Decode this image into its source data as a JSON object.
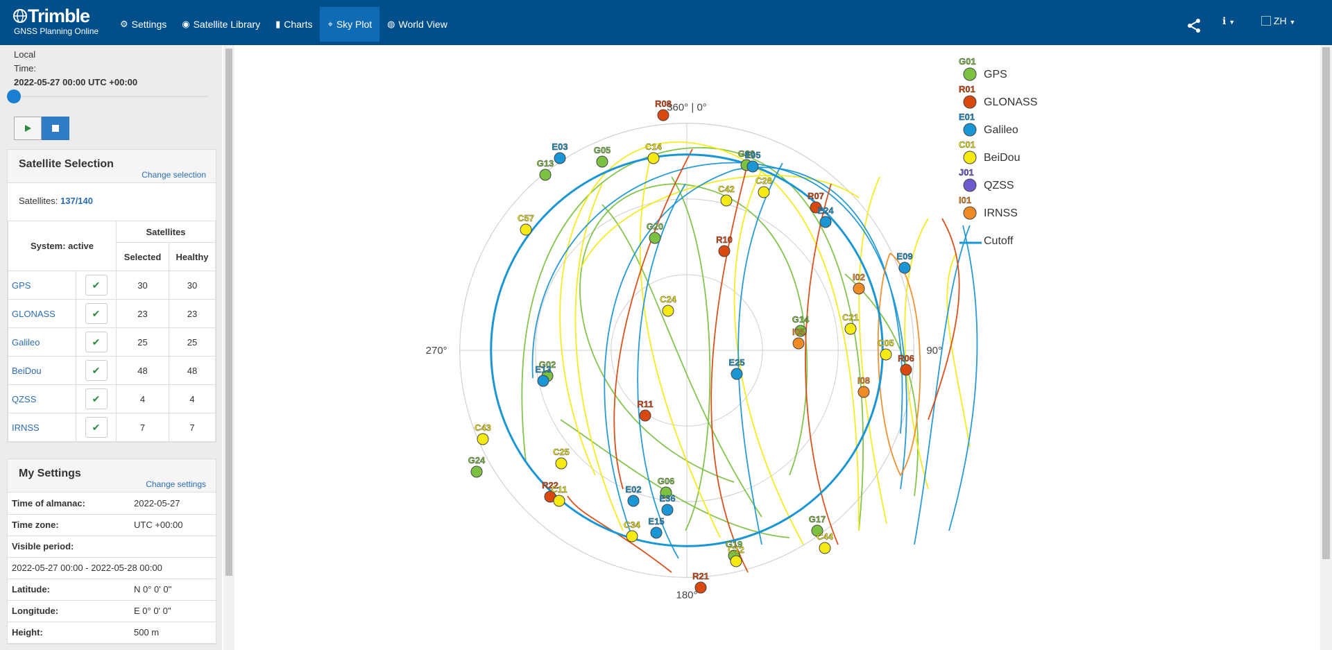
{
  "brand": {
    "logo": "Trimble",
    "subtitle": "GNSS Planning Online"
  },
  "nav": [
    {
      "icon": "gear-icon",
      "glyph": "⚙",
      "label": "Settings"
    },
    {
      "icon": "satellite-icon",
      "glyph": "◉",
      "label": "Satellite Library"
    },
    {
      "icon": "bar-chart-icon",
      "glyph": "▮",
      "label": "Charts"
    },
    {
      "icon": "crosshair-icon",
      "glyph": "⌖",
      "label": "Sky Plot"
    },
    {
      "icon": "globe-icon",
      "glyph": "◍",
      "label": "World View"
    }
  ],
  "language": "ZH",
  "time": {
    "label_local": "Local",
    "label_time": "Time:",
    "value": "2022-05-27 00:00 UTC +00:00"
  },
  "satellite_selection": {
    "title": "Satellite Selection",
    "change_link": "Change selection",
    "count_label": "Satellites:",
    "count_value": "137/140",
    "header_system": "System: active",
    "header_satellites": "Satellites",
    "header_selected": "Selected",
    "header_healthy": "Healthy",
    "systems": [
      {
        "name": "GPS",
        "selected": "30",
        "healthy": "30"
      },
      {
        "name": "GLONASS",
        "selected": "23",
        "healthy": "23"
      },
      {
        "name": "Galileo",
        "selected": "25",
        "healthy": "25"
      },
      {
        "name": "BeiDou",
        "selected": "48",
        "healthy": "48"
      },
      {
        "name": "QZSS",
        "selected": "4",
        "healthy": "4"
      },
      {
        "name": "IRNSS",
        "selected": "7",
        "healthy": "7"
      }
    ]
  },
  "my_settings": {
    "title": "My Settings",
    "change_link": "Change settings",
    "rows": [
      {
        "key": "Time of almanac:",
        "value": "2022-05-27"
      },
      {
        "key": "Time zone:",
        "value": "UTC +00:00"
      },
      {
        "key": "Visible period:",
        "value": ""
      },
      {
        "key": "",
        "value": "2022-05-27 00:00 - 2022-05-28 00:00",
        "full": true
      },
      {
        "key": "Latitude:",
        "value": "N 0° 0' 0\""
      },
      {
        "key": "Longitude:",
        "value": "E 0° 0' 0\""
      },
      {
        "key": "Height:",
        "value": "500 m"
      }
    ]
  },
  "skyplot": {
    "labels": {
      "north": "360° | 0°",
      "east": "90°",
      "south": "180°",
      "west": "270°"
    },
    "colors": {
      "GPS": "#7cc242",
      "GLONASS": "#d9480f",
      "Galileo": "#1a96d4",
      "BeiDou": "#f5ea14",
      "QZSS": "#6a5acd",
      "IRNSS": "#f08a24",
      "cutoff": "#1a96d4"
    },
    "legend": [
      {
        "code": "G01",
        "label": "GPS",
        "system": "GPS"
      },
      {
        "code": "R01",
        "label": "GLONASS",
        "system": "GLONASS"
      },
      {
        "code": "E01",
        "label": "Galileo",
        "system": "Galileo"
      },
      {
        "code": "C01",
        "label": "BeiDou",
        "system": "BeiDou"
      },
      {
        "code": "J01",
        "label": "QZSS",
        "system": "QZSS"
      },
      {
        "code": "I01",
        "label": "IRNSS",
        "system": "IRNSS"
      },
      {
        "code": "",
        "label": "Cutoff",
        "system": "cutoff"
      }
    ],
    "satellites": [
      {
        "id": "R08",
        "system": "GLONASS"
      },
      {
        "id": "E03",
        "system": "Galileo"
      },
      {
        "id": "G05",
        "system": "GPS"
      },
      {
        "id": "C14",
        "system": "BeiDou"
      },
      {
        "id": "G13",
        "system": "GPS"
      },
      {
        "id": "G30",
        "system": "GPS"
      },
      {
        "id": "E05",
        "system": "Galileo"
      },
      {
        "id": "C42",
        "system": "BeiDou"
      },
      {
        "id": "C26",
        "system": "BeiDou"
      },
      {
        "id": "R07",
        "system": "GLONASS"
      },
      {
        "id": "E24",
        "system": "Galileo"
      },
      {
        "id": "C57",
        "system": "BeiDou"
      },
      {
        "id": "G20",
        "system": "GPS"
      },
      {
        "id": "R10",
        "system": "GLONASS"
      },
      {
        "id": "E09",
        "system": "Galileo"
      },
      {
        "id": "I02",
        "system": "IRNSS"
      },
      {
        "id": "C24",
        "system": "BeiDou"
      },
      {
        "id": "C21",
        "system": "BeiDou"
      },
      {
        "id": "G14",
        "system": "GPS"
      },
      {
        "id": "I05",
        "system": "IRNSS"
      },
      {
        "id": "C05",
        "system": "BeiDou"
      },
      {
        "id": "R06",
        "system": "GLONASS"
      },
      {
        "id": "E25",
        "system": "Galileo"
      },
      {
        "id": "G02",
        "system": "GPS"
      },
      {
        "id": "E13",
        "system": "Galileo"
      },
      {
        "id": "I08",
        "system": "IRNSS"
      },
      {
        "id": "R11",
        "system": "GLONASS"
      },
      {
        "id": "C43",
        "system": "BeiDou"
      },
      {
        "id": "C25",
        "system": "BeiDou"
      },
      {
        "id": "G24",
        "system": "GPS"
      },
      {
        "id": "R22",
        "system": "GLONASS"
      },
      {
        "id": "C11",
        "system": "BeiDou"
      },
      {
        "id": "E02",
        "system": "Galileo"
      },
      {
        "id": "G06",
        "system": "GPS"
      },
      {
        "id": "E36",
        "system": "Galileo"
      },
      {
        "id": "E15",
        "system": "Galileo"
      },
      {
        "id": "C34",
        "system": "BeiDou"
      },
      {
        "id": "G17",
        "system": "GPS"
      },
      {
        "id": "C44",
        "system": "BeiDou"
      },
      {
        "id": "G19",
        "system": "GPS"
      },
      {
        "id": "C12",
        "system": "BeiDou"
      },
      {
        "id": "R21",
        "system": "GLONASS"
      }
    ]
  }
}
